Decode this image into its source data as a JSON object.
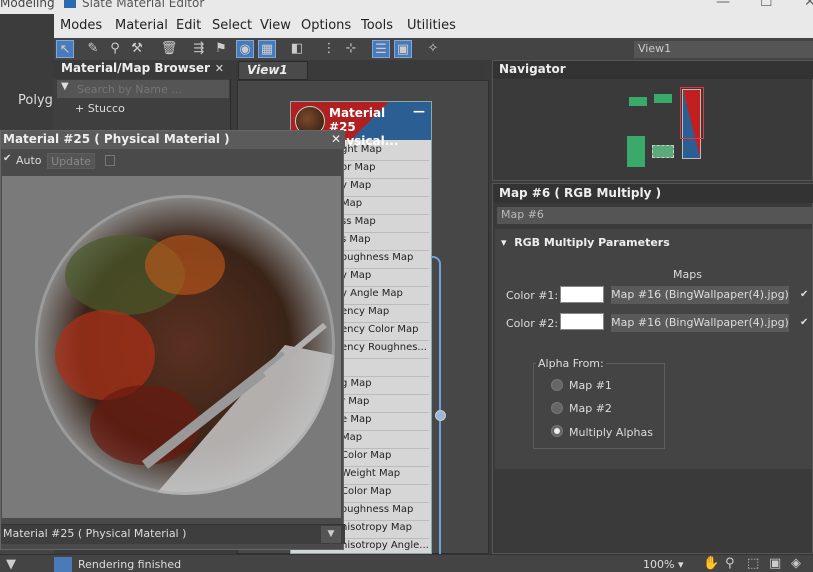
{
  "titlebar": {
    "left_text": "Modeling",
    "title": "Slate Material Editor",
    "minimize": "—",
    "maximize": "☐",
    "close": "✕"
  },
  "menu": [
    "Modes",
    "Material",
    "Edit",
    "Select",
    "View",
    "Options",
    "Tools",
    "Utilities"
  ],
  "left_strip": {
    "label": "Polyg"
  },
  "view_combo": "View1",
  "browser": {
    "title": "Material/Map Browser",
    "close": "✕",
    "search_placeholder": "Search by Name ...",
    "item": "+ Stucco"
  },
  "view_tab": "View1",
  "node": {
    "title": "Material #25 Physical...",
    "minimize": "—",
    "slots": [
      "ght Map",
      "or Map",
      "y Map",
      " Map",
      "ss Map",
      "s Map",
      "oughness Map",
      "y Map",
      "y Angle Map",
      "ency Map",
      "ency Color Map",
      "ency Roughnes...",
      "",
      "g Map",
      "r Map",
      "e Map",
      "Map",
      "Color Map",
      "Weight Map",
      "Color Map",
      "oughness Map",
      "nisotropy Map",
      "nisotropy Angle..."
    ]
  },
  "preview": {
    "title": "Material #25  ( Physical Material )",
    "close": "✕",
    "auto_label": "Auto",
    "auto_checked": true,
    "update_label": "Update",
    "footer_select": "Material #25  ( Physical Material )",
    "dropdown_arrow": "▼"
  },
  "navigator": {
    "title": "Navigator"
  },
  "props": {
    "title": "Map #6  ( RGB Multiply )",
    "map_name": "Map #6",
    "rollout": "RGB Multiply Parameters",
    "maps_label": "Maps",
    "color1_label": "Color #1:",
    "color2_label": "Color #2:",
    "map1_button": "Map #16 (BingWallpaper(4).jpg)",
    "map2_button": "Map #16 (BingWallpaper(4).jpg)",
    "map1_checked": true,
    "map2_checked": true,
    "alpha_from_label": "Alpha From:",
    "alpha_options": [
      "Map #1",
      "Map #2",
      "Multiply Alphas"
    ],
    "alpha_selected": "Multiply Alphas"
  },
  "status": {
    "text": "Rendering finished",
    "zoom": "100%"
  },
  "colors": {
    "accent": "#4a7ab8",
    "node_red": "#b02020",
    "node_blue": "#2b5f93",
    "nav_green": "#3aaa6a"
  }
}
